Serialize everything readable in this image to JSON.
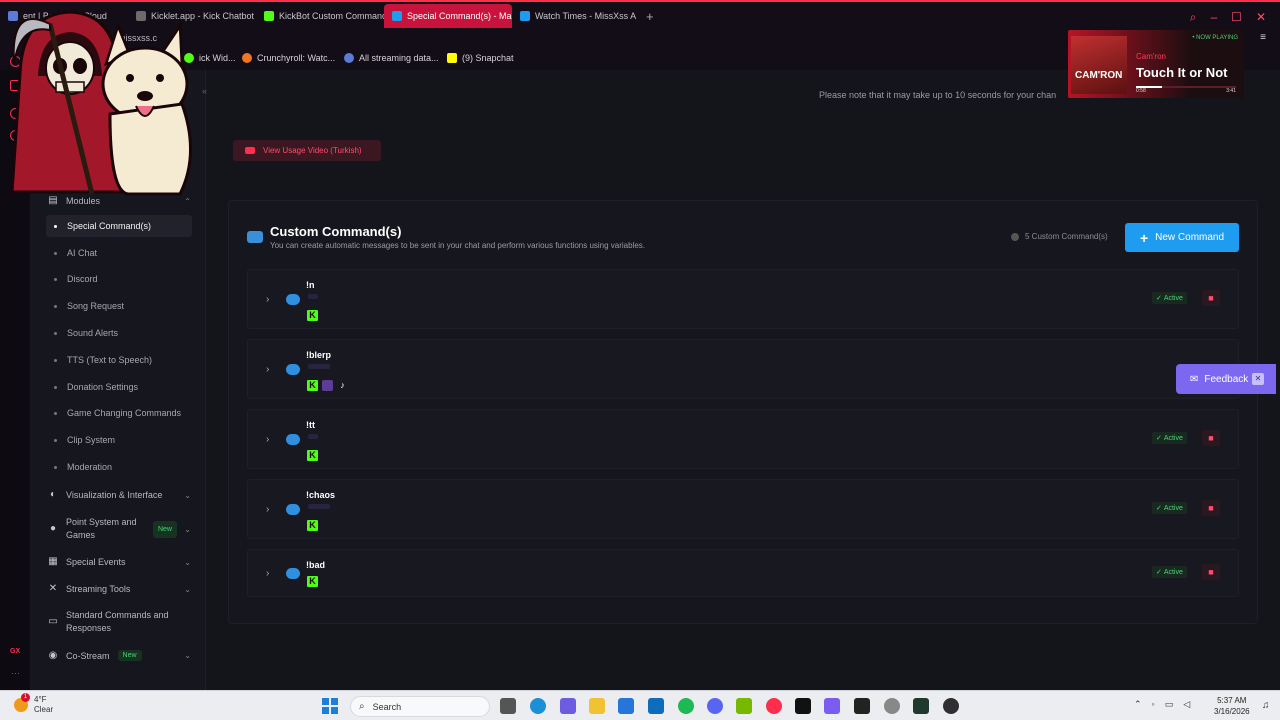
{
  "browser": {
    "tabs": [
      {
        "label": "ent | BotRix — Cloud",
        "color": "#5b7bd6"
      },
      {
        "label": "Kicklet.app - Kick Chatbot",
        "color": "#6c6c6c"
      },
      {
        "label": "KickBot Custom Command",
        "color": "#53fc18"
      },
      {
        "label": "Special Command(s) - Ma",
        "color": "#1e9cf0"
      },
      {
        "label": "Watch Times - MissXss A",
        "color": "#1e9cf0"
      }
    ],
    "address_fragment": "missxss.c",
    "bookmarks": [
      {
        "label": "ick Wid...",
        "color": "#53fc18"
      },
      {
        "label": "Crunchyroll: Watc...",
        "color": "#f47521"
      },
      {
        "label": "All streaming data...",
        "color": "#5b7bd6"
      },
      {
        "label": "(9) Snapchat",
        "color": "#fffc00"
      }
    ]
  },
  "now_playing": {
    "label": "• NOW PLAYING",
    "artist": "Cam'ron",
    "title": "Touch It or Not",
    "elapsed": "0:58",
    "duration": "3:41",
    "progress": 0.26,
    "album_text": "CAM'RON"
  },
  "sidebar": {
    "section_label": "Modules",
    "items": [
      {
        "label": "Special Command(s)",
        "active": true
      },
      {
        "label": "AI Chat"
      },
      {
        "label": "Discord"
      },
      {
        "label": "Song Request"
      },
      {
        "label": "Sound Alerts"
      },
      {
        "label": "TTS (Text to Speech)"
      },
      {
        "label": "Donation Settings"
      },
      {
        "label": "Game Changing Commands"
      },
      {
        "label": "Clip System"
      },
      {
        "label": "Moderation"
      }
    ],
    "groups": [
      {
        "label": "Visualization & Interface",
        "icon": "palette-icon"
      },
      {
        "label": "Point System and Games",
        "badge": "New",
        "icon": "coin-icon"
      },
      {
        "label": "Special Events",
        "icon": "calendar-icon"
      },
      {
        "label": "Streaming Tools",
        "icon": "tools-icon"
      },
      {
        "label": "Standard Commands and Responses",
        "icon": "keyboard-icon"
      },
      {
        "label": "Co-Stream",
        "badge": "New",
        "icon": "users-icon"
      }
    ]
  },
  "main": {
    "notice": "Please note that it may take up to 10 seconds for your chan",
    "usage_button": "View Usage Video (Turkish)",
    "panel_title": "Custom Command(s)",
    "panel_subtitle": "You can create automatic messages to be sent in your chat and perform various functions using variables.",
    "command_count": "5 Custom Command(s)",
    "new_command_label": "New Command",
    "commands": [
      {
        "name": "!n",
        "platforms": [
          "kick"
        ],
        "status": "Active"
      },
      {
        "name": "!blerp",
        "platforms": [
          "kick",
          "twitch",
          "tiktok"
        ],
        "status": "Active"
      },
      {
        "name": "!tt",
        "platforms": [
          "kick"
        ],
        "status": "Active"
      },
      {
        "name": "!chaos",
        "platforms": [
          "kick"
        ],
        "status": "Active"
      },
      {
        "name": "!bad",
        "platforms": [
          "kick"
        ],
        "status": "Active"
      }
    ]
  },
  "feedback_label": "Feedback",
  "taskbar": {
    "temperature": "4°F",
    "weather": "Clear",
    "notification_count": "1",
    "search_placeholder": "Search",
    "time": "5:37 AM",
    "date": "3/16/2026"
  },
  "colors": {
    "accent": "#ff2e4d",
    "primary": "#1e9cf0",
    "kick": "#53fc18",
    "active_status": "#4bd17a",
    "feedback": "#7b67f0"
  }
}
